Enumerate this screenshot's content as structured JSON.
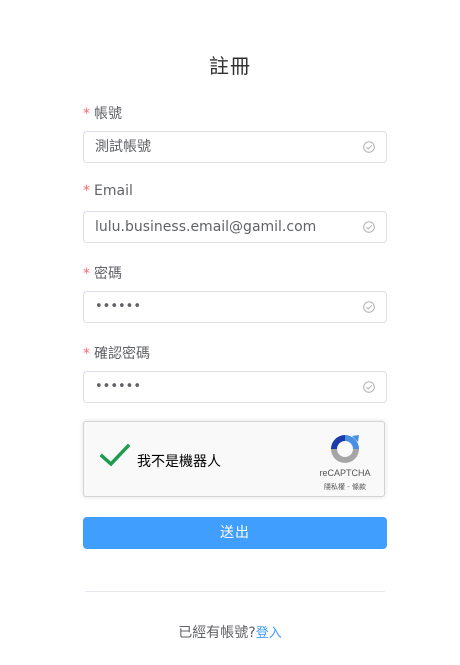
{
  "title": "註冊",
  "form": {
    "required_mark": "*",
    "fields": [
      {
        "label": "帳號",
        "value": "測試帳號"
      },
      {
        "label": "Email",
        "value": "lulu.business.email@gamil.com"
      },
      {
        "label": "密碼",
        "value": "••••••"
      },
      {
        "label": "確認密碼",
        "value": "••••••"
      }
    ]
  },
  "recaptcha": {
    "label": "我不是機器人",
    "brand": "reCAPTCHA",
    "terms": "隱私權 - 條款",
    "checked": true
  },
  "submit_label": "送出",
  "footer": {
    "prompt": "已經有帳號?",
    "login_link": "登入"
  },
  "colors": {
    "primary": "#409eff",
    "required": "#f56c6c",
    "check_green": "#1e9b4f"
  }
}
